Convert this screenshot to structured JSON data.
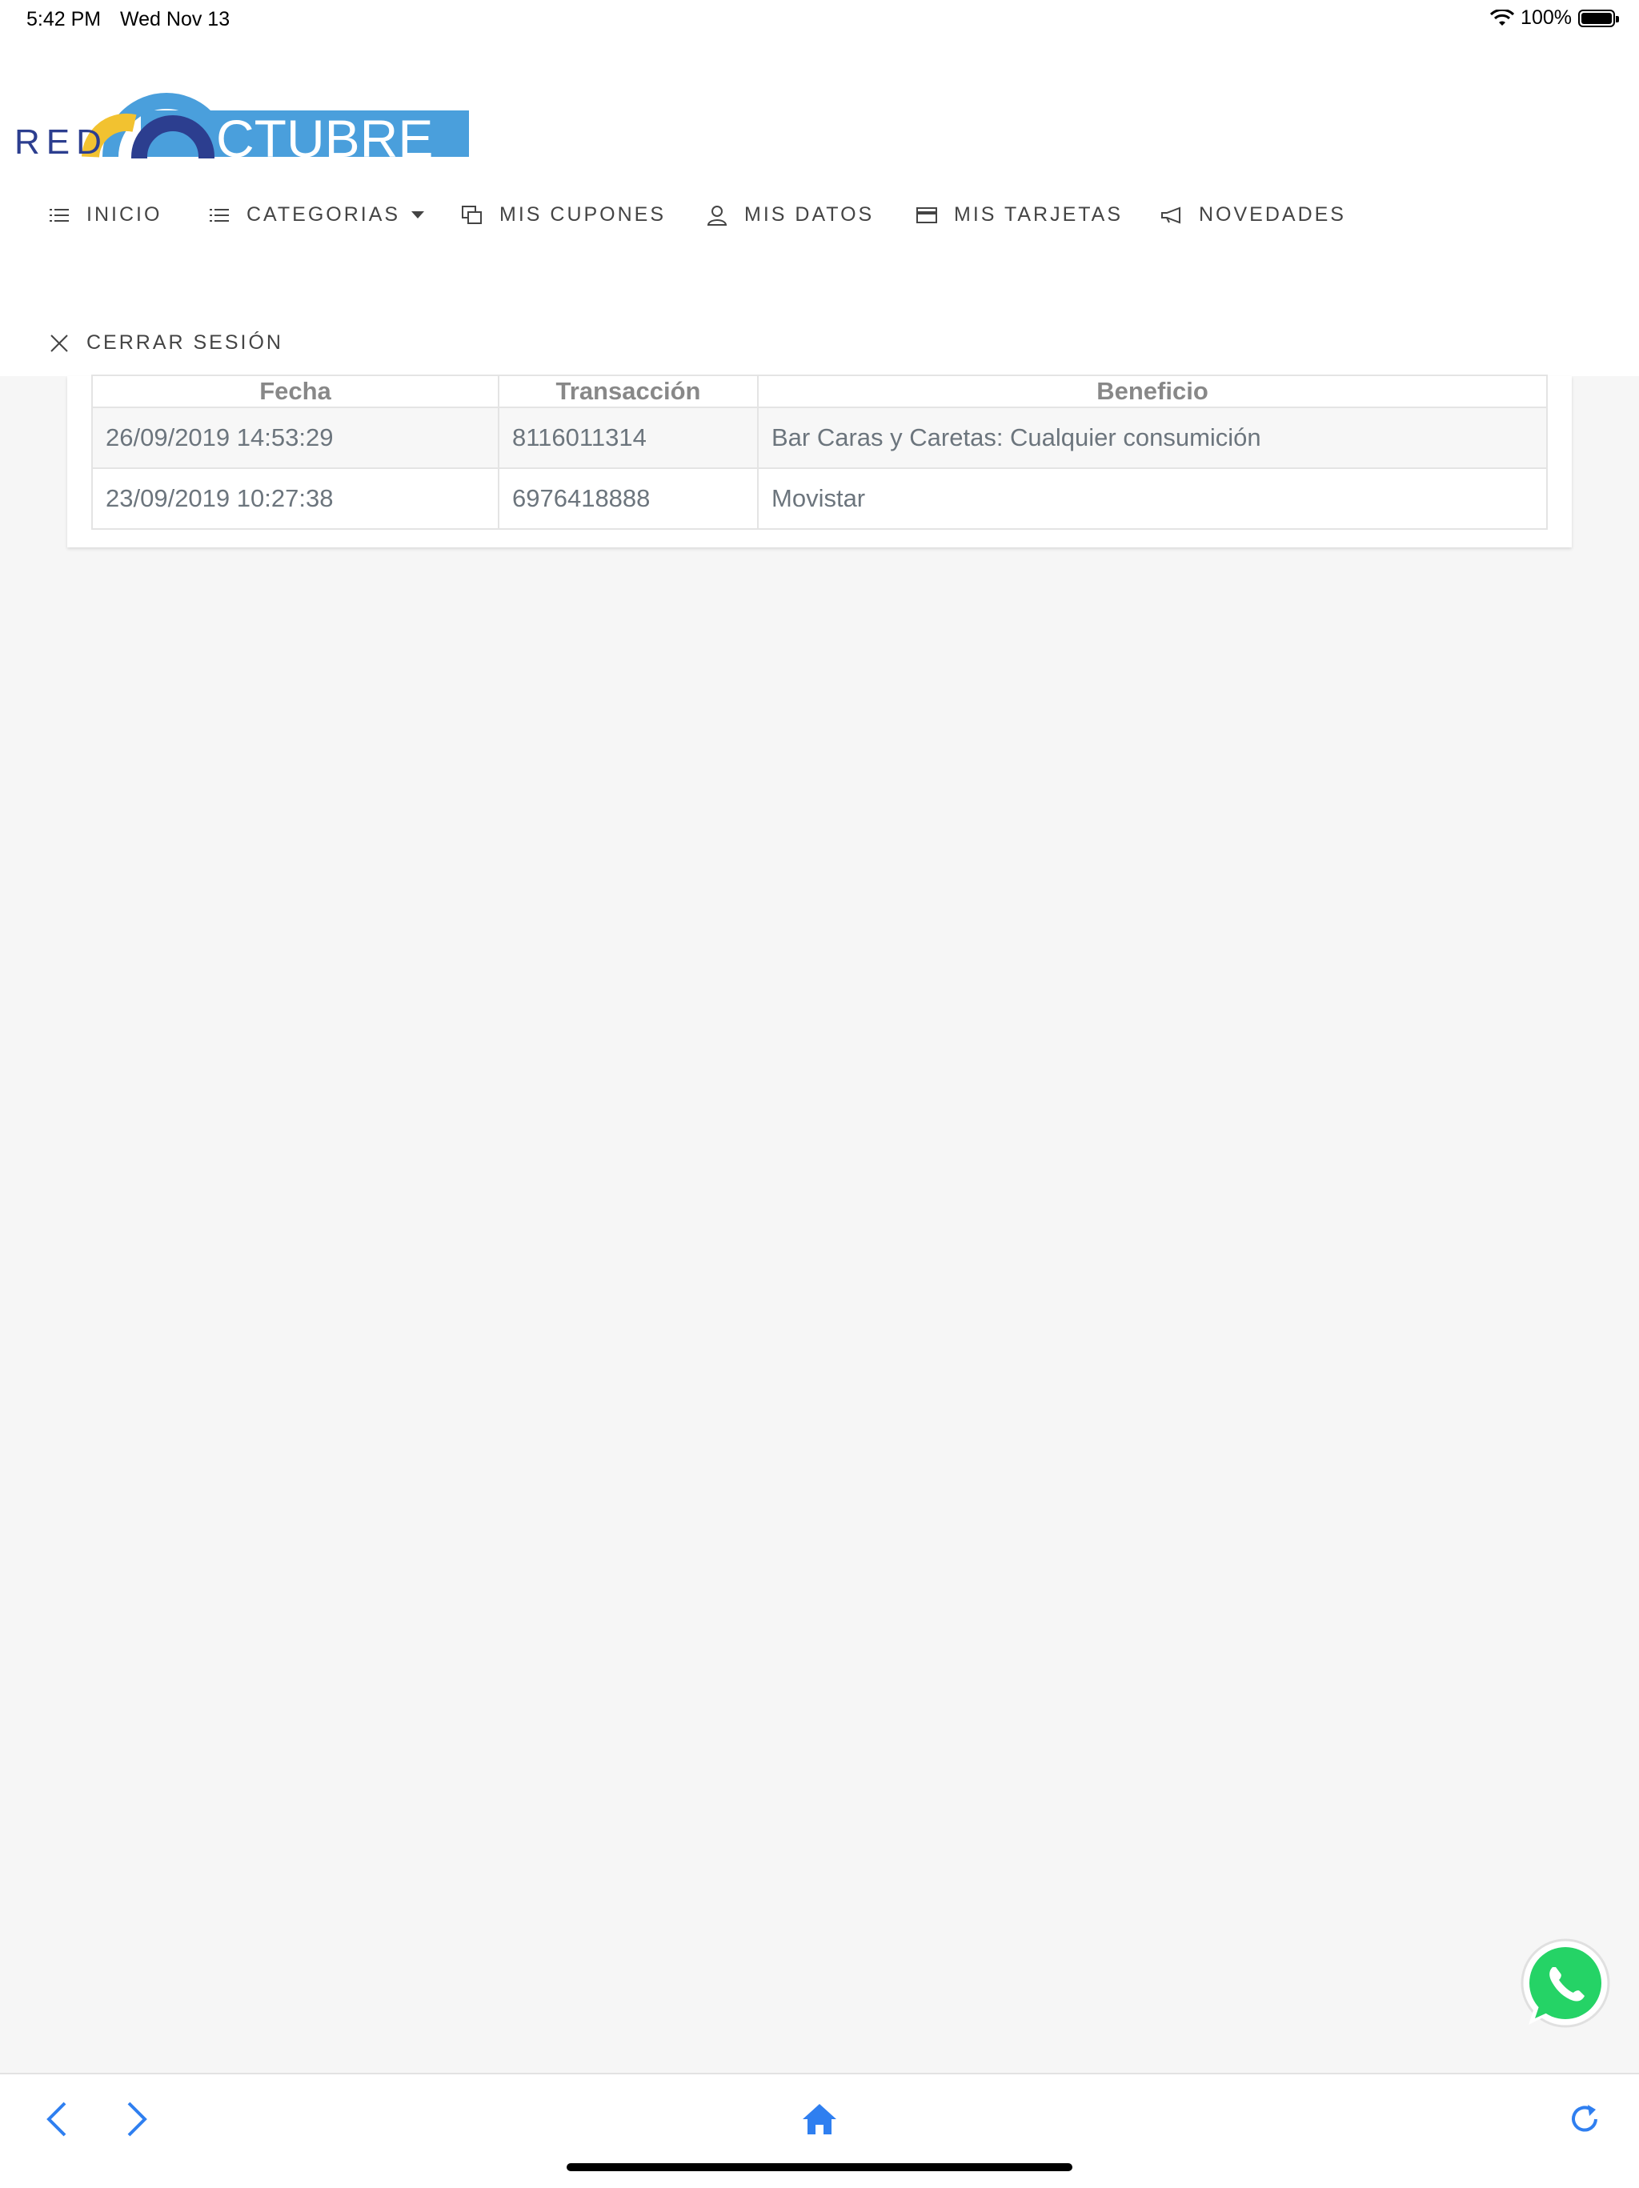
{
  "status_bar": {
    "time": "5:42 PM",
    "date": "Wed Nov 13",
    "battery": "100%"
  },
  "logo": {
    "prefix": "RED",
    "word": "CTUBRE"
  },
  "nav": {
    "items": [
      {
        "label": "INICIO",
        "icon": "list-icon"
      },
      {
        "label": "CATEGORIAS",
        "icon": "list-icon",
        "dropdown": true
      },
      {
        "label": "MIS CUPONES",
        "icon": "coupons-icon"
      },
      {
        "label": "MIS DATOS",
        "icon": "user-icon"
      },
      {
        "label": "MIS TARJETAS",
        "icon": "card-icon"
      },
      {
        "label": "NOVEDADES",
        "icon": "megaphone-icon"
      }
    ],
    "logout": {
      "label": "CERRAR SESIÓN",
      "icon": "close-icon"
    }
  },
  "table": {
    "headers": [
      "Fecha",
      "Transacción",
      "Beneficio"
    ],
    "rows": [
      [
        "26/09/2019 14:53:29",
        "8116011314",
        "Bar Caras y Caretas: Cualquier consumición"
      ],
      [
        "23/09/2019 10:27:38",
        "6976418888",
        "Movistar"
      ]
    ]
  },
  "colors": {
    "brand_blue": "#4a9fdc",
    "brand_dark": "#2c3e8f",
    "brand_yellow": "#f2c230",
    "link_blue": "#2f7ff0",
    "whatsapp_green": "#25d366"
  },
  "toolbar": {
    "icons": [
      "back-arrow-icon",
      "forward-arrow-icon",
      "home-icon",
      "reload-icon"
    ]
  }
}
